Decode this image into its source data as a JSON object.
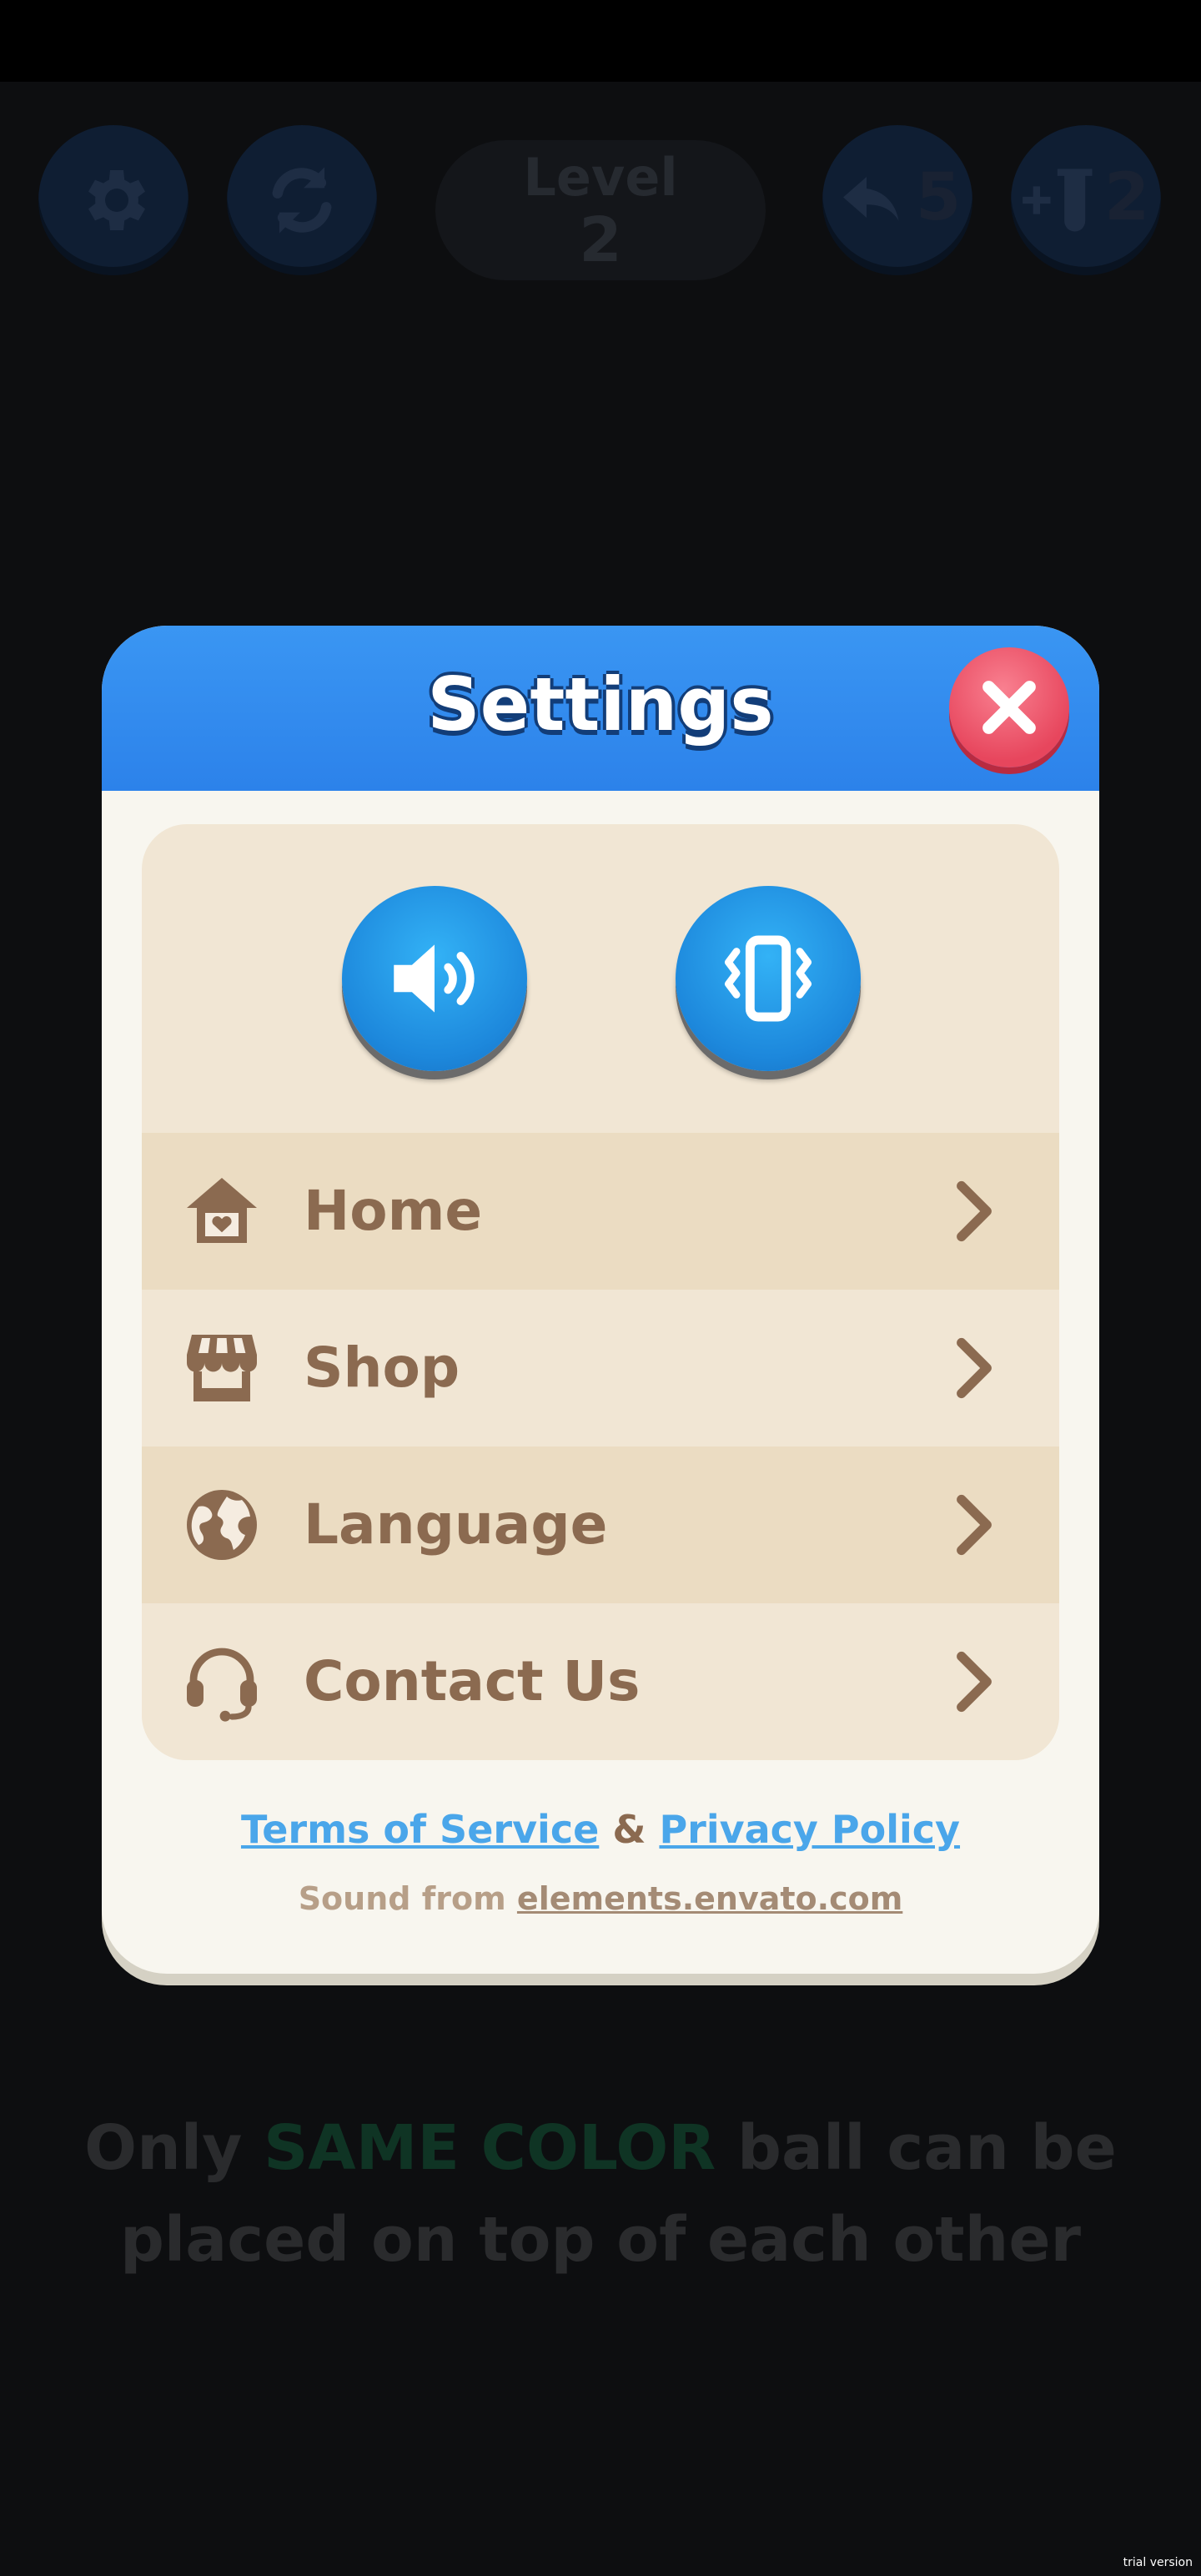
{
  "hud": {
    "settings_icon": "gear-icon",
    "restart_icon": "refresh-icon",
    "level_label": "Level",
    "level_number": "2",
    "undo_icon": "undo-arrow-icon",
    "undo_count": "5",
    "add_tube_icon": "add-tube-icon",
    "add_tube_count": "2"
  },
  "dialog": {
    "title": "Settings",
    "close_icon": "close-x-icon",
    "toggles": [
      {
        "icon": "speaker-sound-icon"
      },
      {
        "icon": "phone-vibrate-icon"
      }
    ],
    "menu": [
      {
        "label": "Home",
        "icon": "home-heart-icon"
      },
      {
        "label": "Shop",
        "icon": "shop-icon"
      },
      {
        "label": "Language",
        "icon": "globe-icon"
      },
      {
        "label": "Contact Us",
        "icon": "headset-icon"
      }
    ],
    "links": {
      "terms": "Terms of Service",
      "separator": "&",
      "privacy": "Privacy Policy"
    },
    "credit": {
      "prefix": "Sound from",
      "link": "elements.envato.com"
    }
  },
  "hint": {
    "part1": "Only",
    "accent": "SAME COLOR",
    "part2": "ball can be",
    "line2": "placed on top of each other"
  },
  "watermark": "trial version",
  "colors": {
    "header_blue": "#2c82ea",
    "close_red": "#e7465d",
    "toggle_blue": "#1d88dc",
    "menu_text": "#8b6a50",
    "link_blue": "#4aa6ea",
    "hint_accent": "#0f3424"
  }
}
